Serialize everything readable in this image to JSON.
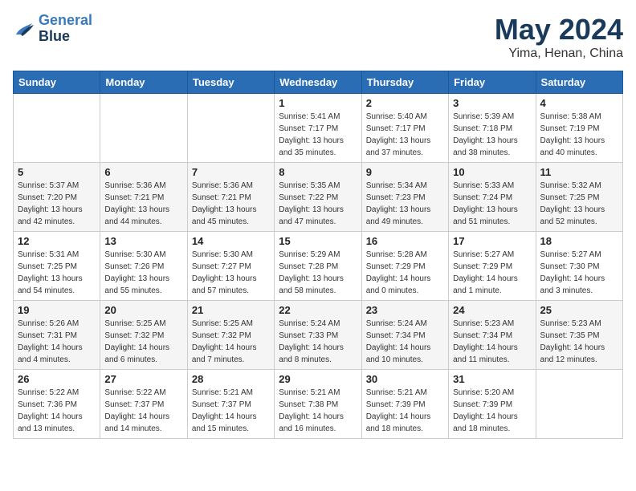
{
  "header": {
    "logo_line1": "General",
    "logo_line2": "Blue",
    "month": "May 2024",
    "location": "Yima, Henan, China"
  },
  "weekdays": [
    "Sunday",
    "Monday",
    "Tuesday",
    "Wednesday",
    "Thursday",
    "Friday",
    "Saturday"
  ],
  "weeks": [
    [
      {
        "day": "",
        "info": ""
      },
      {
        "day": "",
        "info": ""
      },
      {
        "day": "",
        "info": ""
      },
      {
        "day": "1",
        "info": "Sunrise: 5:41 AM\nSunset: 7:17 PM\nDaylight: 13 hours\nand 35 minutes."
      },
      {
        "day": "2",
        "info": "Sunrise: 5:40 AM\nSunset: 7:17 PM\nDaylight: 13 hours\nand 37 minutes."
      },
      {
        "day": "3",
        "info": "Sunrise: 5:39 AM\nSunset: 7:18 PM\nDaylight: 13 hours\nand 38 minutes."
      },
      {
        "day": "4",
        "info": "Sunrise: 5:38 AM\nSunset: 7:19 PM\nDaylight: 13 hours\nand 40 minutes."
      }
    ],
    [
      {
        "day": "5",
        "info": "Sunrise: 5:37 AM\nSunset: 7:20 PM\nDaylight: 13 hours\nand 42 minutes."
      },
      {
        "day": "6",
        "info": "Sunrise: 5:36 AM\nSunset: 7:21 PM\nDaylight: 13 hours\nand 44 minutes."
      },
      {
        "day": "7",
        "info": "Sunrise: 5:36 AM\nSunset: 7:21 PM\nDaylight: 13 hours\nand 45 minutes."
      },
      {
        "day": "8",
        "info": "Sunrise: 5:35 AM\nSunset: 7:22 PM\nDaylight: 13 hours\nand 47 minutes."
      },
      {
        "day": "9",
        "info": "Sunrise: 5:34 AM\nSunset: 7:23 PM\nDaylight: 13 hours\nand 49 minutes."
      },
      {
        "day": "10",
        "info": "Sunrise: 5:33 AM\nSunset: 7:24 PM\nDaylight: 13 hours\nand 51 minutes."
      },
      {
        "day": "11",
        "info": "Sunrise: 5:32 AM\nSunset: 7:25 PM\nDaylight: 13 hours\nand 52 minutes."
      }
    ],
    [
      {
        "day": "12",
        "info": "Sunrise: 5:31 AM\nSunset: 7:25 PM\nDaylight: 13 hours\nand 54 minutes."
      },
      {
        "day": "13",
        "info": "Sunrise: 5:30 AM\nSunset: 7:26 PM\nDaylight: 13 hours\nand 55 minutes."
      },
      {
        "day": "14",
        "info": "Sunrise: 5:30 AM\nSunset: 7:27 PM\nDaylight: 13 hours\nand 57 minutes."
      },
      {
        "day": "15",
        "info": "Sunrise: 5:29 AM\nSunset: 7:28 PM\nDaylight: 13 hours\nand 58 minutes."
      },
      {
        "day": "16",
        "info": "Sunrise: 5:28 AM\nSunset: 7:29 PM\nDaylight: 14 hours\nand 0 minutes."
      },
      {
        "day": "17",
        "info": "Sunrise: 5:27 AM\nSunset: 7:29 PM\nDaylight: 14 hours\nand 1 minute."
      },
      {
        "day": "18",
        "info": "Sunrise: 5:27 AM\nSunset: 7:30 PM\nDaylight: 14 hours\nand 3 minutes."
      }
    ],
    [
      {
        "day": "19",
        "info": "Sunrise: 5:26 AM\nSunset: 7:31 PM\nDaylight: 14 hours\nand 4 minutes."
      },
      {
        "day": "20",
        "info": "Sunrise: 5:25 AM\nSunset: 7:32 PM\nDaylight: 14 hours\nand 6 minutes."
      },
      {
        "day": "21",
        "info": "Sunrise: 5:25 AM\nSunset: 7:32 PM\nDaylight: 14 hours\nand 7 minutes."
      },
      {
        "day": "22",
        "info": "Sunrise: 5:24 AM\nSunset: 7:33 PM\nDaylight: 14 hours\nand 8 minutes."
      },
      {
        "day": "23",
        "info": "Sunrise: 5:24 AM\nSunset: 7:34 PM\nDaylight: 14 hours\nand 10 minutes."
      },
      {
        "day": "24",
        "info": "Sunrise: 5:23 AM\nSunset: 7:34 PM\nDaylight: 14 hours\nand 11 minutes."
      },
      {
        "day": "25",
        "info": "Sunrise: 5:23 AM\nSunset: 7:35 PM\nDaylight: 14 hours\nand 12 minutes."
      }
    ],
    [
      {
        "day": "26",
        "info": "Sunrise: 5:22 AM\nSunset: 7:36 PM\nDaylight: 14 hours\nand 13 minutes."
      },
      {
        "day": "27",
        "info": "Sunrise: 5:22 AM\nSunset: 7:37 PM\nDaylight: 14 hours\nand 14 minutes."
      },
      {
        "day": "28",
        "info": "Sunrise: 5:21 AM\nSunset: 7:37 PM\nDaylight: 14 hours\nand 15 minutes."
      },
      {
        "day": "29",
        "info": "Sunrise: 5:21 AM\nSunset: 7:38 PM\nDaylight: 14 hours\nand 16 minutes."
      },
      {
        "day": "30",
        "info": "Sunrise: 5:21 AM\nSunset: 7:39 PM\nDaylight: 14 hours\nand 18 minutes."
      },
      {
        "day": "31",
        "info": "Sunrise: 5:20 AM\nSunset: 7:39 PM\nDaylight: 14 hours\nand 18 minutes."
      },
      {
        "day": "",
        "info": ""
      }
    ]
  ]
}
